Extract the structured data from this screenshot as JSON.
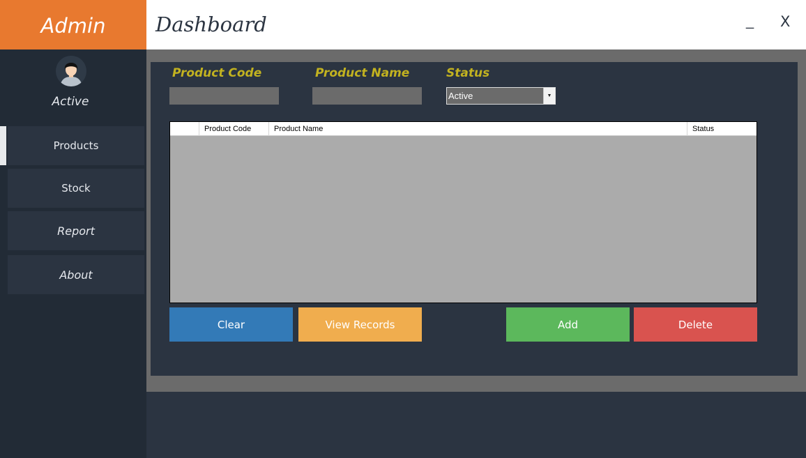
{
  "sidebar": {
    "brand": "Admin",
    "user_status": "Active",
    "items": [
      {
        "label": "Products"
      },
      {
        "label": "Stock"
      },
      {
        "label": "Report"
      },
      {
        "label": "About"
      }
    ]
  },
  "header": {
    "title": "Dashboard",
    "minimize_label": "_",
    "close_label": "X"
  },
  "form": {
    "product_code_label": "Product Code",
    "product_code_value": "",
    "product_name_label": "Product Name",
    "product_name_value": "",
    "status_label": "Status",
    "status_selected": "Active"
  },
  "grid": {
    "columns": [
      "",
      "Product Code",
      "Product Name",
      "Status"
    ],
    "rows": []
  },
  "buttons": {
    "clear": "Clear",
    "view_records": "View Records",
    "add": "Add",
    "delete": "Delete"
  },
  "colors": {
    "brand": "#e8792f",
    "sidebar": "#222b36",
    "panel": "#2b3441",
    "label_accent": "#c2b220",
    "clear": "#337ab7",
    "view_records": "#f0ad4e",
    "add": "#5cb85c",
    "delete": "#d9534f"
  },
  "icons": {
    "avatar": "user-avatar-icon",
    "dropdown": "chevron-down-icon"
  }
}
